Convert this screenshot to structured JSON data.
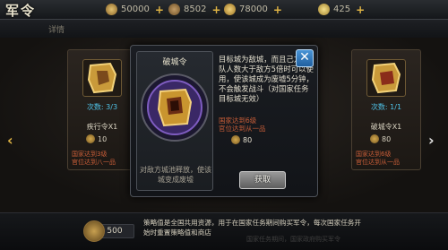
{
  "window": {
    "title": "军令"
  },
  "resources": [
    {
      "icon": "copper-coin-icon",
      "value": "50000",
      "color": "#c89f4a"
    },
    {
      "icon": "wood-icon",
      "value": "8502",
      "color": "#9a7446"
    },
    {
      "icon": "gold-coin-icon",
      "value": "78000",
      "color": "#d7b04c"
    },
    {
      "icon": "ingot-icon",
      "value": "425",
      "color": "#e0c060"
    }
  ],
  "subtab": {
    "label": "详情"
  },
  "cards": [
    {
      "uses": "次数: 3/3",
      "name": "疾行令X1",
      "cost": "10",
      "requirement": "国家达到3级\n官位达到八一品"
    },
    {
      "uses": "次数: 1/1",
      "name": "破城令X1",
      "cost": "80",
      "requirement": "国家达到6级\n官位达到从一品"
    }
  ],
  "popup": {
    "item_name": "破城令",
    "short_desc": "对敌方城池释放，使该城变成废墟",
    "full_desc": "目标城为敌城，而且己方部队人数大于敌方5倍时可以使用，使该城成为废墟5分钟，不会触发战斗（对国家任务目标城无效）",
    "requirement": "国家达到6级\n官位达到从一品",
    "cost": "80",
    "get_button": "获取",
    "close_label": "✕"
  },
  "bottom": {
    "points": "500",
    "note": "策略值是全国共用资源，用于在国家任务期间购买军令，每次国家任务开始时重置策略值和商店",
    "faded_note": "国家任务期间，国家政府购买军令"
  },
  "colors": {
    "accent_blue": "#4fc3e8",
    "requirement_red": "#c85d38",
    "arrow_gold": "#e0b444"
  }
}
